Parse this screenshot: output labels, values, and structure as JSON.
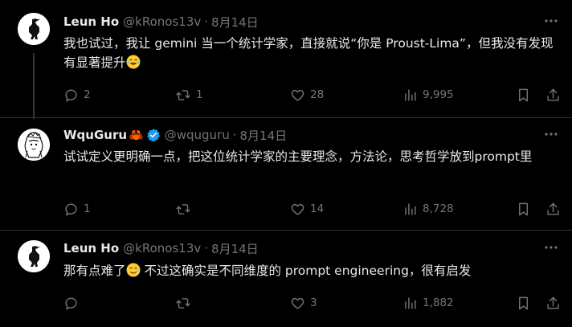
{
  "tweets": [
    {
      "name": "Leun Ho",
      "handle": "@kRonos13v",
      "separator": "·",
      "date": "8月14日",
      "text_before": "我也试过，我让 gemini 当一个统计学家，直接就说“你是 Proust-Lima”，但我没有发现有显著提升",
      "emoji": "joy-emoji",
      "stats": {
        "replies": "2",
        "retweets": "1",
        "likes": "28",
        "views": "9,995"
      }
    },
    {
      "name": "WquGuru",
      "name_emoji": "🦀",
      "handle": "@wquguru",
      "separator": "·",
      "date": "8月14日",
      "text": "试试定义更明确一点，把这位统计学家的主要理念，方法论，思考哲学放到prompt里",
      "stats": {
        "replies": "1",
        "retweets": "",
        "likes": "14",
        "views": "8,728"
      }
    },
    {
      "name": "Leun Ho",
      "handle": "@kRonos13v",
      "separator": "·",
      "date": "8月14日",
      "text_before": "那有点难了",
      "emoji": "smiling-tear-emoji",
      "text_after": " 不过这确实是不同维度的 prompt engineering，很有启发",
      "stats": {
        "replies": "",
        "retweets": "",
        "likes": "3",
        "views": "1,882"
      }
    }
  ],
  "icons": {
    "reply": "reply-icon",
    "retweet": "retweet-icon",
    "like": "heart-icon",
    "views": "views-icon",
    "bookmark": "bookmark-icon",
    "share": "share-icon",
    "more": "more-icon",
    "verified": "verified-badge-icon"
  },
  "colors": {
    "background": "#000000",
    "text": "#e7e9ea",
    "muted": "#71767b",
    "divider": "#2f3336",
    "verified": "#1d9bf0"
  }
}
